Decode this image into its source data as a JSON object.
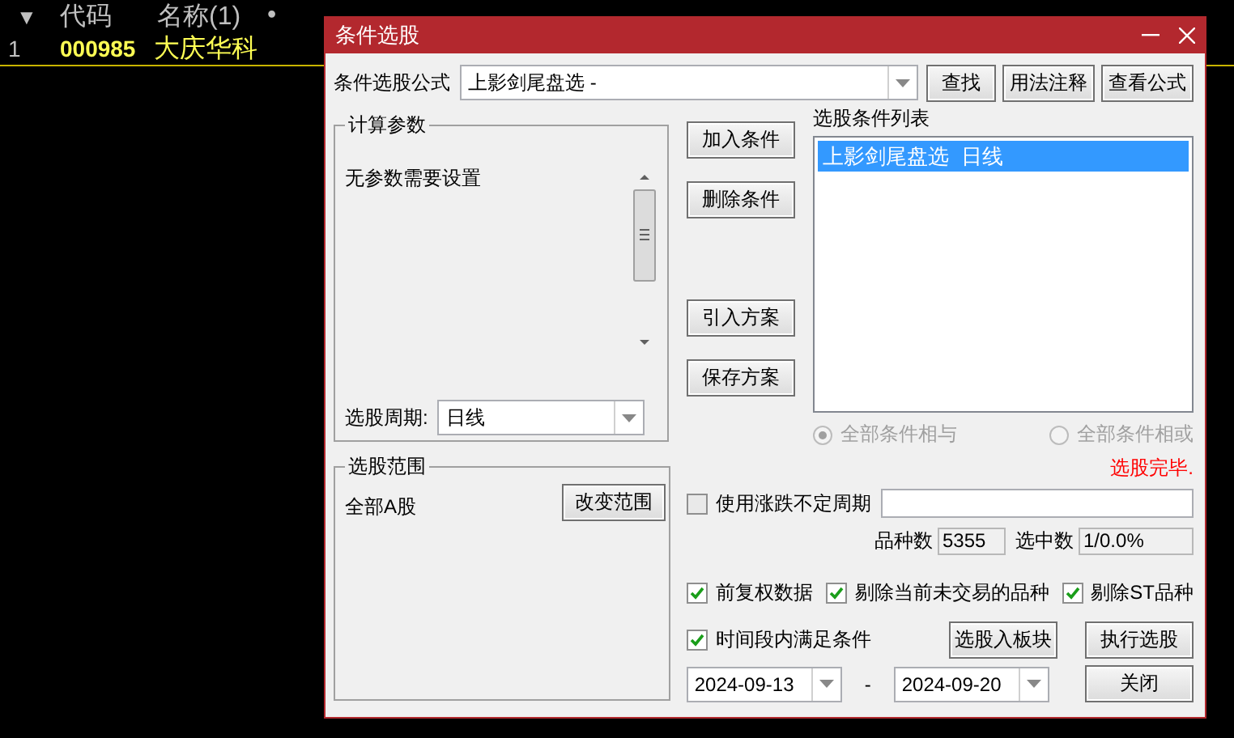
{
  "background_table": {
    "sort_mark": "▼",
    "columns": [
      "代码",
      "名称(1)",
      "•"
    ],
    "rows": [
      {
        "index": "1",
        "code": "000985",
        "name": "大庆华科"
      }
    ]
  },
  "dialog": {
    "title": "条件选股",
    "formula": {
      "label": "条件选股公式",
      "value": "上影剑尾盘选 -"
    },
    "top_buttons": [
      "查找",
      "用法注释",
      "查看公式"
    ],
    "params_group": {
      "title": "计算参数",
      "message": "无参数需要设置",
      "period_label": "选股周期:",
      "period_value": "日线"
    },
    "side_buttons": [
      "加入条件",
      "删除条件",
      "引入方案",
      "保存方案"
    ],
    "condition_list": {
      "label": "选股条件列表",
      "items": [
        {
          "text": "上影剑尾盘选  日线",
          "selected": true
        }
      ]
    },
    "combine_modes": [
      {
        "label": "全部条件相与",
        "selected": true,
        "disabled": true
      },
      {
        "label": "全部条件相或",
        "selected": false,
        "disabled": true
      }
    ],
    "status": "选股完毕.",
    "range_group": {
      "title": "选股范围",
      "value": "全部A股",
      "button": "改变范围"
    },
    "variable_period": {
      "label": "使用涨跌不定周期",
      "checked": false
    },
    "stats": [
      {
        "label": "品种数",
        "value": "5355"
      },
      {
        "label": "选中数",
        "value": "1/0.0%"
      }
    ],
    "options": [
      {
        "label": "前复权数据",
        "checked": true
      },
      {
        "label": "剔除当前未交易的品种",
        "checked": true
      },
      {
        "label": "剔除ST品种",
        "checked": true
      }
    ],
    "time_range": {
      "label": "时间段内满足条件",
      "checked": true
    },
    "date_from": "2024-09-13",
    "date_separator": "-",
    "date_to": "2024-09-20",
    "bottom_buttons": [
      "选股入板块",
      "执行选股",
      "关闭"
    ]
  }
}
